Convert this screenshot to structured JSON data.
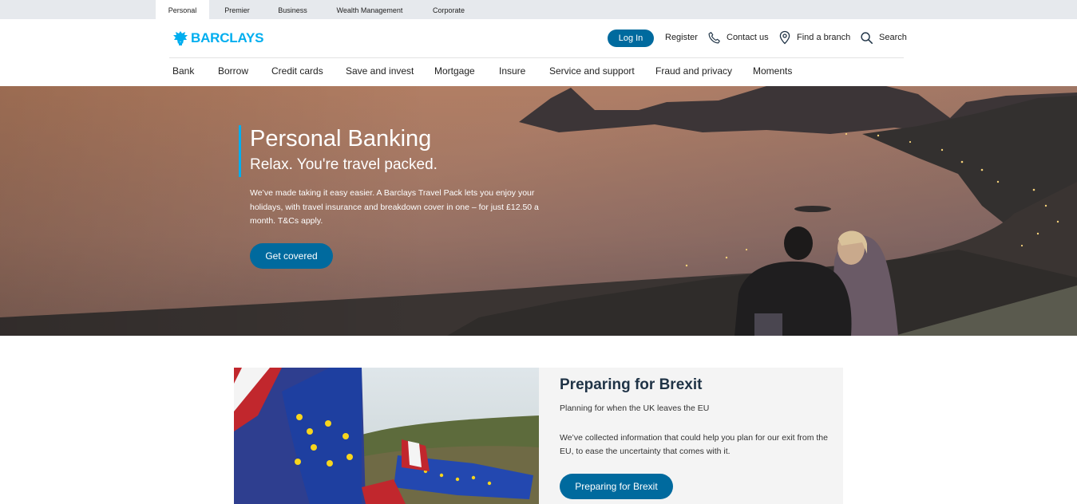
{
  "segments": [
    "Personal",
    "Premier",
    "Business",
    "Wealth Management",
    "Corporate"
  ],
  "brand": {
    "name": "BARCLAYS",
    "color": "#00aeef"
  },
  "header": {
    "login_label": "Log In",
    "register_label": "Register",
    "contact_label": "Contact us",
    "branch_label": "Find a branch",
    "search_label": "Search"
  },
  "nav": [
    "Bank",
    "Borrow",
    "Credit cards",
    "Save and invest",
    "Mortgage",
    "Insure",
    "Service and support",
    "Fraud and privacy",
    "Moments"
  ],
  "hero": {
    "title": "Personal Banking",
    "subtitle": "Relax. You're travel packed.",
    "body": "We’ve made taking it easy easier. A Barclays Travel Pack lets you enjoy your holidays, with travel insurance and breakdown cover in one – for just £12.50 a month. T&Cs apply.",
    "cta": "Get covered"
  },
  "brexit": {
    "title": "Preparing for Brexit",
    "lead": "Planning for when the UK leaves the EU",
    "body": "We’ve collected information that could help you plan for our exit from the EU, to ease the uncertainty that comes with it.",
    "cta": "Preparing for Brexit"
  },
  "colors": {
    "primary_button": "#006a9e",
    "accent": "#00aeef",
    "segment_bar": "#e6e9ed"
  }
}
